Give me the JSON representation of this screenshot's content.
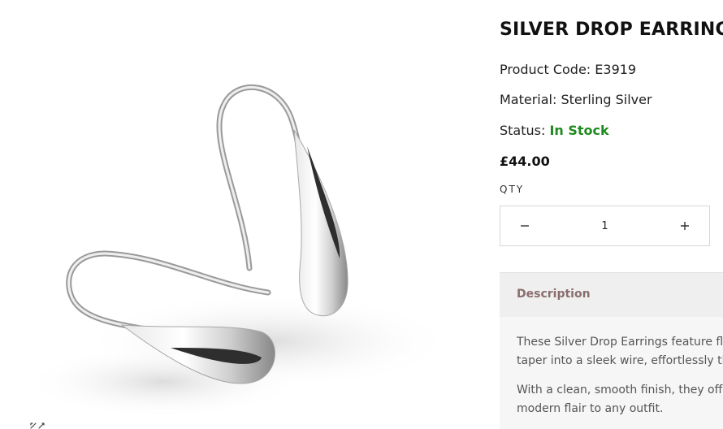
{
  "product": {
    "title": "SILVER DROP EARRINGS",
    "code_label": "Product Code: ",
    "code_value": "E3919",
    "material_label": "Material: ",
    "material_value": "Sterling Silver",
    "status_label": "Status: ",
    "status_value": "In Stock",
    "price": "£44.00"
  },
  "quantity": {
    "label": "QTY",
    "value": "1",
    "minus_icon": "minus-icon",
    "plus_icon": "plus-icon"
  },
  "description": {
    "header": "Description",
    "para1_line1": "These Silver Drop Earrings feature flui",
    "para1_line2": "taper into a sleek wire, effortlessly thr",
    "para2_line1": "With a clean, smooth finish, they offer",
    "para2_line2": "modern flair to any outfit."
  },
  "gallery": {
    "zoom_icon": "expand-icon"
  },
  "colors": {
    "status_green": "#1f8a1f",
    "description_header_text": "#8a6e6e",
    "description_header_bg": "#efefef",
    "description_body_bg": "#f6f6f6"
  }
}
